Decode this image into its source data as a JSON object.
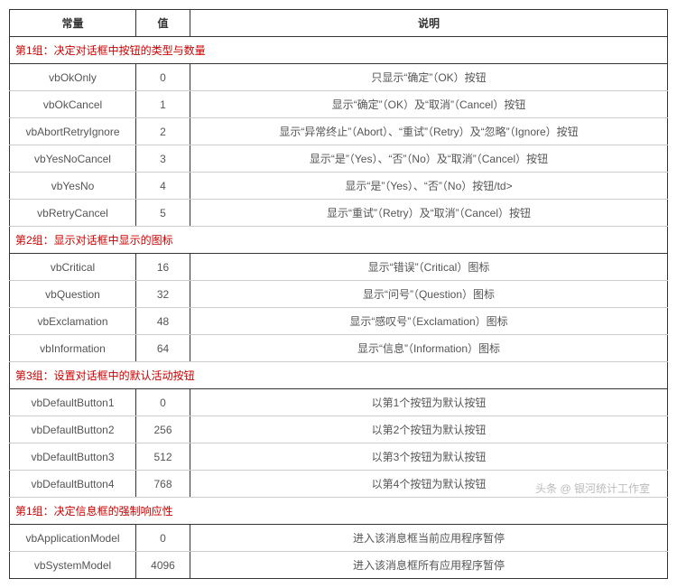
{
  "headers": {
    "const": "常量",
    "value": "值",
    "desc": "说明"
  },
  "groups": [
    {
      "title": "第1组：决定对话框中按钮的类型与数量",
      "rows": [
        {
          "const": "vbOkOnly",
          "value": "0",
          "desc": "只显示“确定”（OK）按钮"
        },
        {
          "const": "vbOkCancel",
          "value": "1",
          "desc": "显示“确定”（OK）及“取消”（Cancel）按钮"
        },
        {
          "const": "vbAbortRetryIgnore",
          "value": "2",
          "desc": "显示“异常终止”（Abort）、“重试”（Retry）及“忽略”（Ignore）按钮"
        },
        {
          "const": "vbYesNoCancel",
          "value": "3",
          "desc": "显示“是”（Yes）、“否”（No）及“取消”（Cancel）按钮"
        },
        {
          "const": "vbYesNo",
          "value": "4",
          "desc": "显示“是”（Yes）、“否”（No）按钮/td>"
        },
        {
          "const": "vbRetryCancel",
          "value": "5",
          "desc": "显示“重试”（Retry）及“取消”（Cancel）按钮"
        }
      ]
    },
    {
      "title": "第2组：显示对话框中显示的图标",
      "rows": [
        {
          "const": "vbCritical",
          "value": "16",
          "desc": "显示“错误”（Critical）图标"
        },
        {
          "const": "vbQuestion",
          "value": "32",
          "desc": "显示“问号”（Question）图标"
        },
        {
          "const": "vbExclamation",
          "value": "48",
          "desc": "显示“感叹号”（Exclamation）图标"
        },
        {
          "const": "vbInformation",
          "value": "64",
          "desc": "显示“信息”（Information）图标"
        }
      ]
    },
    {
      "title": "第3组：设置对话框中的默认活动按钮",
      "rows": [
        {
          "const": "vbDefaultButton1",
          "value": "0",
          "desc": "以第1个按钮为默认按钮"
        },
        {
          "const": "vbDefaultButton2",
          "value": "256",
          "desc": "以第2个按钮为默认按钮"
        },
        {
          "const": "vbDefaultButton3",
          "value": "512",
          "desc": "以第3个按钮为默认按钮"
        },
        {
          "const": "vbDefaultButton4",
          "value": "768",
          "desc": "以第4个按钮为默认按钮"
        }
      ]
    },
    {
      "title": "第1组：决定信息框的强制响应性",
      "rows": [
        {
          "const": "vbApplicationModel",
          "value": "0",
          "desc": "进入该消息框当前应用程序暂停"
        },
        {
          "const": "vbSystemModel",
          "value": "4096",
          "desc": "进入该消息框所有应用程序暂停"
        }
      ]
    }
  ],
  "watermark": "头条 @ 银河统计工作室"
}
